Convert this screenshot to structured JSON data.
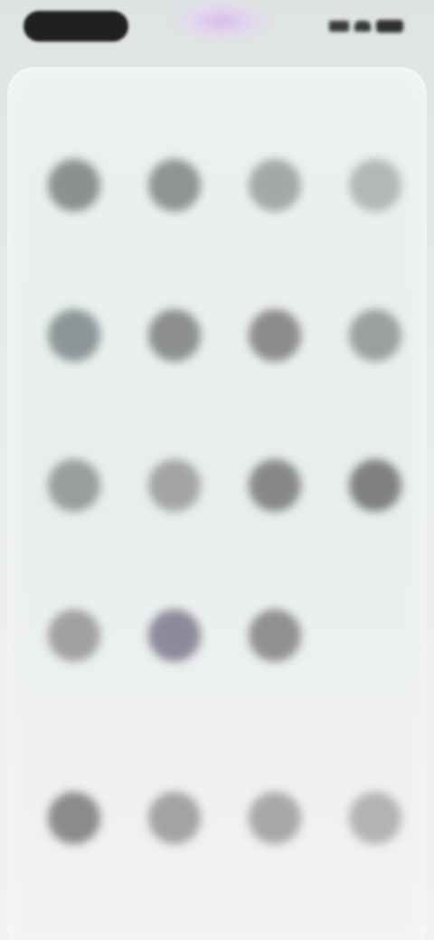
{
  "status_bar": {
    "time": "",
    "icons": [
      "signal-icon",
      "wifi-icon",
      "battery-icon"
    ]
  },
  "sections": [
    {
      "title": "",
      "apps": [
        {
          "label": "",
          "color": "#8a918e"
        },
        {
          "label": "",
          "color": "#8f9491"
        },
        {
          "label": "",
          "color": "#a4a9a7"
        },
        {
          "label": "",
          "color": "#b3b8b6"
        },
        {
          "label": "",
          "color": "#8b9797"
        },
        {
          "label": "",
          "color": "#8d8f8f"
        },
        {
          "label": "",
          "color": "#8e8b8d"
        },
        {
          "label": "",
          "color": "#9aa09d"
        },
        {
          "label": "",
          "color": "#999d9b"
        },
        {
          "label": "",
          "color": "#a3a5a4"
        },
        {
          "label": "",
          "color": "#878989"
        },
        {
          "label": "",
          "color": "#7f8180"
        },
        {
          "label": "",
          "color": "#a0a2a1"
        },
        {
          "label": "",
          "color": "#8e8a9c"
        },
        {
          "label": "",
          "color": "#8f9190"
        }
      ]
    },
    {
      "title": "",
      "apps": [
        {
          "label": "",
          "color": "#8a8c8b"
        },
        {
          "label": "",
          "color": "#a2a4a3"
        },
        {
          "label": "",
          "color": "#a7a9a8"
        },
        {
          "label": "",
          "color": "#b1b4b3"
        }
      ]
    }
  ]
}
